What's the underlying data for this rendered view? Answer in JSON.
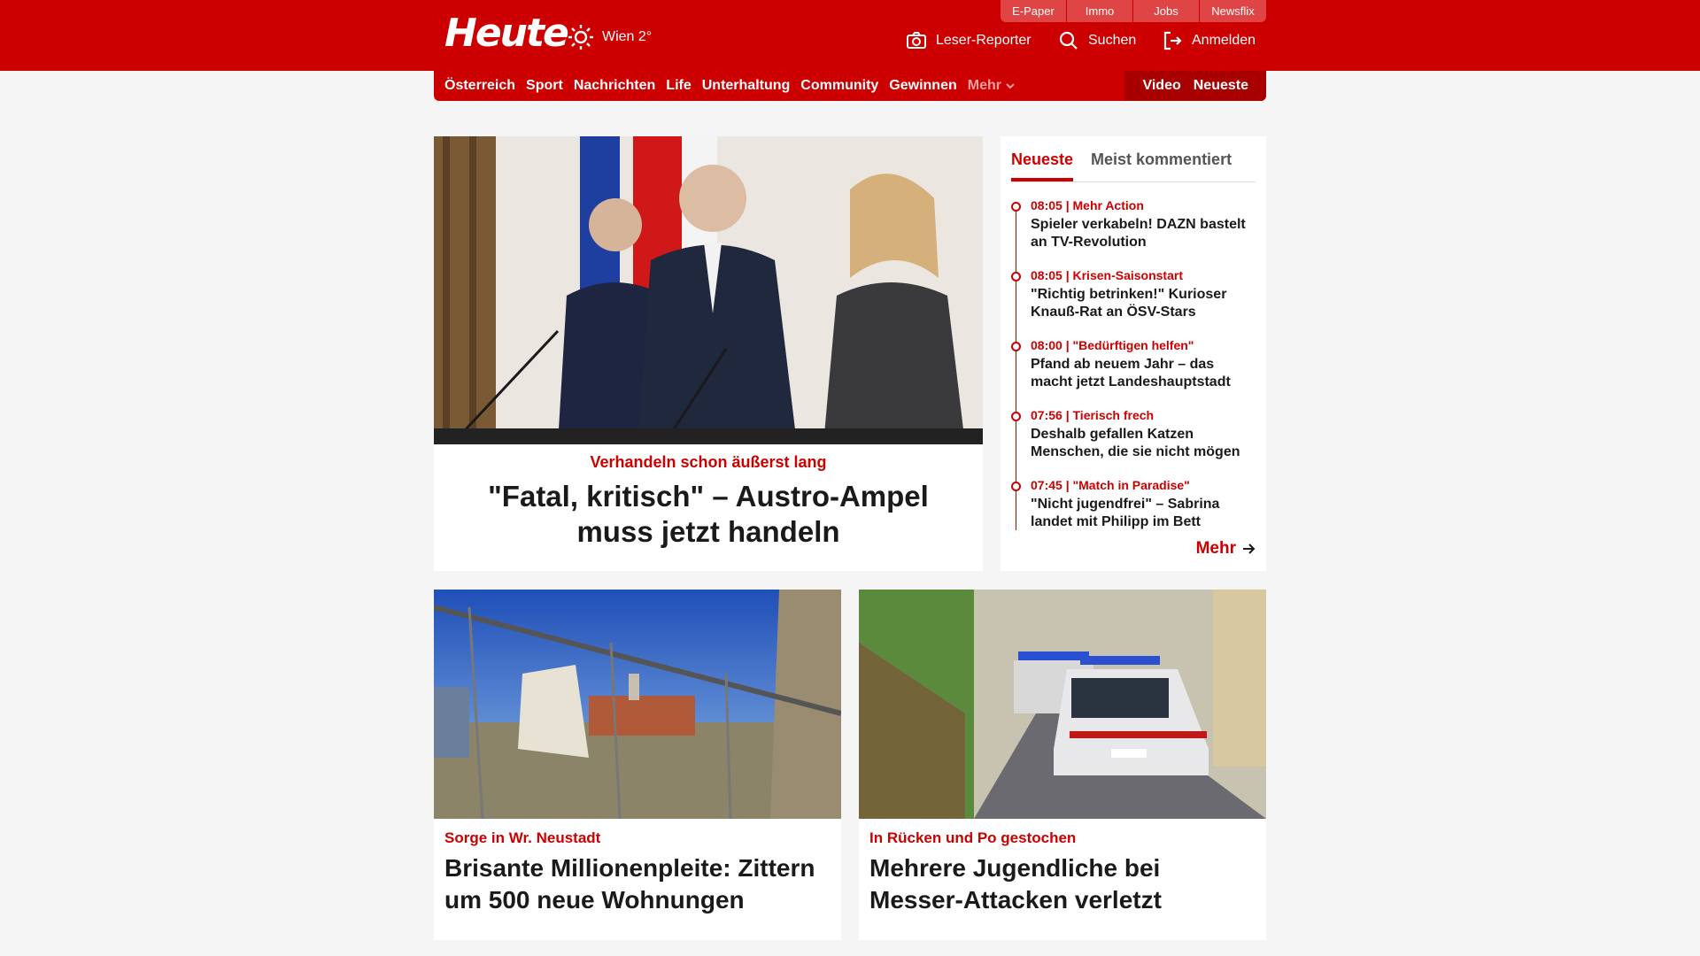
{
  "header": {
    "logo": "Heute",
    "weather": {
      "icon": "sun-icon",
      "label": "Wien 2°"
    },
    "util_tabs": [
      "E-Paper",
      "Immo",
      "Jobs",
      "Newsflix"
    ],
    "leser_reporter": "Leser-Reporter",
    "search": "Suchen",
    "login": "Anmelden"
  },
  "nav": {
    "items": [
      "Österreich",
      "Sport",
      "Nachrichten",
      "Life",
      "Unterhaltung",
      "Community",
      "Gewinnen"
    ],
    "more": "Mehr",
    "video": "Video",
    "latest": "Neueste"
  },
  "hero": {
    "kicker": "Verhandeln schon äußerst lang",
    "title": "\"Fatal, kritisch\" – Austro-Ampel muss jetzt handeln"
  },
  "sidebar": {
    "tabs": [
      "Neueste",
      "Meist kommentiert"
    ],
    "items": [
      {
        "meta": "08:05 | Mehr Action",
        "title": "Spieler verkabeln! DAZN bastelt an TV-Revolution"
      },
      {
        "meta": "08:05 | Krisen-Saisonstart",
        "title": "\"Richtig betrinken!\" Kurioser Knauß-Rat an ÖSV-Stars"
      },
      {
        "meta": "08:00 | \"Bedürftigen helfen\"",
        "title": "Pfand ab neuem Jahr – das macht jetzt Landeshauptstadt"
      },
      {
        "meta": "07:56 | Tierisch frech",
        "title": "Deshalb gefallen Katzen Menschen, die sie nicht mögen"
      },
      {
        "meta": "07:45 | \"Match in Paradise\"",
        "title": "\"Nicht jugendfrei\" – Sabrina landet mit Philipp im Bett"
      }
    ],
    "more": "Mehr"
  },
  "cards": [
    {
      "kicker": "Sorge in Wr. Neustadt",
      "title": "Brisante Millionenpleite: Zittern um 500 neue Wohnungen"
    },
    {
      "kicker": "In Rücken und Po gestochen",
      "title": "Mehrere Jugendliche bei Messer-Attacken verletzt"
    }
  ],
  "colors": {
    "brand_red": "#cc0000",
    "dark_red": "#a80000",
    "background": "#f5f5f5"
  }
}
